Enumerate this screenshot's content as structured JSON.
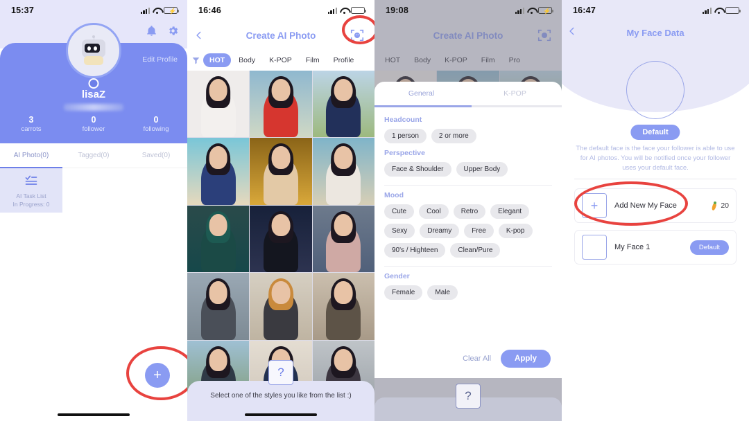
{
  "panels": {
    "profile": {
      "status": {
        "time": "15:37"
      },
      "icons": {
        "bell": "bell-icon",
        "gear": "gear-icon"
      },
      "edit_profile": "Edit Profile",
      "username": "lisaZ",
      "stats": [
        {
          "num": "3",
          "label": "carrots"
        },
        {
          "num": "0",
          "label": "follower"
        },
        {
          "num": "0",
          "label": "following"
        }
      ],
      "tabs": [
        {
          "label": "AI Photo(0)",
          "active": true
        },
        {
          "label": "Tagged(0)",
          "active": false
        },
        {
          "label": "Saved(0)",
          "active": false
        }
      ],
      "task_card": {
        "title": "AI Task List",
        "subtitle": "In Progress: 0"
      },
      "fab_label": "+"
    },
    "create": {
      "status": {
        "time": "16:46"
      },
      "title": "Create AI Photo",
      "face_scan_icon": "face-scan-icon",
      "filter_icon": "funnel-icon",
      "category_tabs": [
        {
          "label": "HOT",
          "active": true
        },
        {
          "label": "Body",
          "active": false
        },
        {
          "label": "K-POP",
          "active": false
        },
        {
          "label": "Film",
          "active": false
        },
        {
          "label": "Profile",
          "active": false
        }
      ],
      "hint": "Select one of the styles you like from the list :)",
      "question_mark": "?"
    },
    "filters": {
      "status": {
        "time": "19:08"
      },
      "title": "Create AI Photo",
      "category_tabs": [
        {
          "label": "HOT",
          "active": false
        },
        {
          "label": "Body",
          "active": false
        },
        {
          "label": "K-POP",
          "active": false
        },
        {
          "label": "Film",
          "active": false
        },
        {
          "label": "Pro",
          "active": false
        }
      ],
      "sheet_tabs": [
        {
          "label": "General",
          "active": true
        },
        {
          "label": "K-POP",
          "active": false
        }
      ],
      "groups": [
        {
          "title": "Headcount",
          "options": [
            "1 person",
            "2 or more"
          ]
        },
        {
          "title": "Perspective",
          "options": [
            "Face & Shoulder",
            "Upper Body"
          ]
        },
        {
          "title": "Mood",
          "options": [
            "Cute",
            "Cool",
            "Retro",
            "Elegant",
            "Sexy",
            "Dreamy",
            "Free",
            "K-pop",
            "90's / Highteen",
            "Clean/Pure"
          ]
        },
        {
          "title": "Gender",
          "options": [
            "Female",
            "Male"
          ]
        }
      ],
      "clear_all": "Clear All",
      "apply": "Apply",
      "question_mark": "?"
    },
    "face_data": {
      "status": {
        "time": "16:47"
      },
      "title": "My Face Data",
      "default_badge": "Default",
      "description": "The default face is the face your follower is able to use for AI photos. You will be notified once your follower uses your default face.",
      "rows": [
        {
          "label": "Add New My Face",
          "thumb": "plus-icon",
          "cost": "20",
          "cost_icon": "carrot-icon"
        },
        {
          "label": "My Face 1",
          "thumb": "",
          "badge": "Default"
        }
      ]
    }
  },
  "colors": {
    "accent": "#8a9bf2",
    "hero": "#7b8cf0",
    "lavender": "#e8e8f8",
    "annotation": "#e8433f"
  }
}
